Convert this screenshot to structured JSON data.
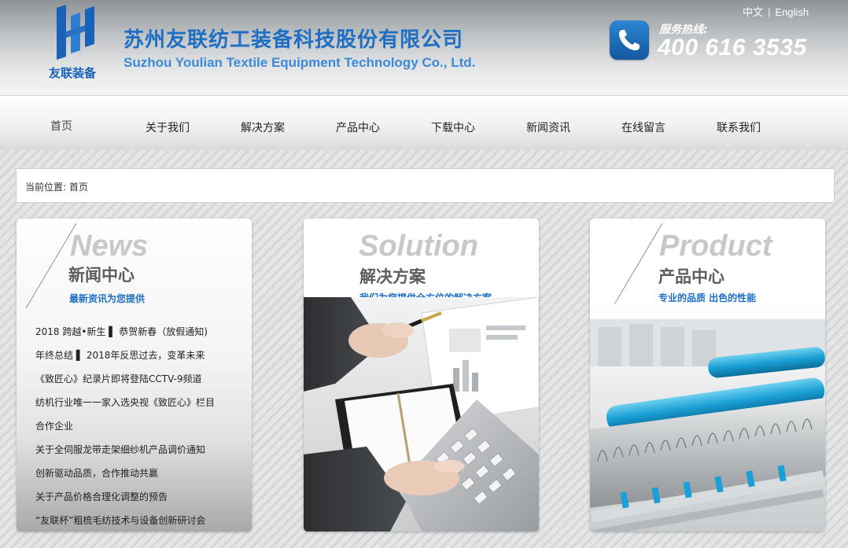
{
  "header": {
    "logo_text": "友联装备",
    "company_name_cn": "苏州友联纺工装备科技股份有限公司",
    "company_name_en": "Suzhou Youlian Textile Equipment Technology Co., Ltd.",
    "lang_cn": "中文",
    "lang_sep": "|",
    "lang_en": "English",
    "hotline_label": "服务热线:",
    "hotline_number": "400 616 3535",
    "colors": {
      "brand_blue": "#1e6fc4",
      "phone_blue": "#2d86d3"
    }
  },
  "nav": {
    "items": [
      {
        "label": "首页",
        "active": true
      },
      {
        "label": "关于我们"
      },
      {
        "label": "解决方案"
      },
      {
        "label": "产品中心"
      },
      {
        "label": "下载中心"
      },
      {
        "label": "新闻资讯"
      },
      {
        "label": "在线留言"
      },
      {
        "label": "联系我们"
      }
    ]
  },
  "breadcrumb": {
    "prefix": "当前位置:",
    "current": "首页"
  },
  "cards": {
    "news": {
      "title_en": "News",
      "title_cn": "新闻中心",
      "subtitle": "最新资讯为您提供",
      "items": [
        "2018 跨越•新生 ▌ 恭贺新春（放假通知)",
        "年终总结 ▌ 2018年反思过去，变革未来",
        "《致匠心》纪录片即将登陆CCTV-9频道",
        "纺机行业唯一一家入选央视《致匠心》栏目",
        "合作企业",
        "关于全伺服龙带走架细纱机产品调价通知",
        "创新驱动品质，合作推动共赢",
        "关于产品价格合理化调整的预告",
        "“友联杯”粗梳毛纺技术与设备创新研讨会"
      ]
    },
    "solution": {
      "title_en": "Solution",
      "title_cn": "解决方案",
      "subtitle": "我们为您提供全方位的解决方案"
    },
    "product": {
      "title_en": "Product",
      "title_cn": "产品中心",
      "subtitle": "专业的品质 出色的性能"
    }
  }
}
